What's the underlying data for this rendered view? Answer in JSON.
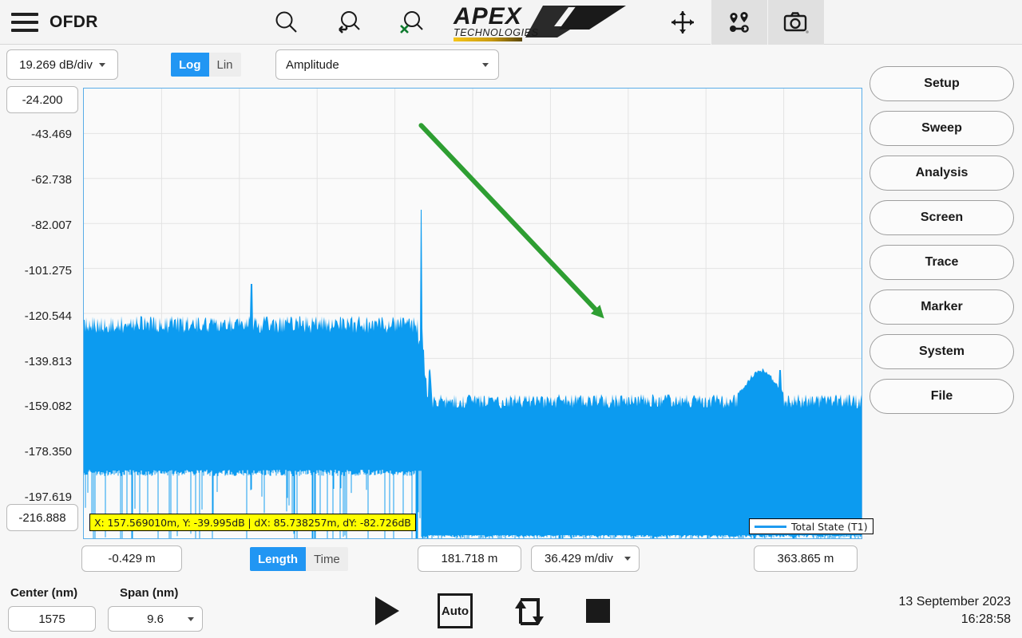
{
  "topbar": {
    "app_title": "OFDR",
    "menu_icon": "hamburger-menu-icon",
    "zoom_icon": "magnifier-zoom-icon",
    "zoom_back_icon": "magnifier-undo-icon",
    "zoom_clear_icon": "magnifier-clear-icon",
    "logo_main": "APEX",
    "logo_sub": "TECHNOLOGIES",
    "move_icon": "move-crosshair-icon",
    "markers_icon": "markers-pins-icon",
    "camera_icon": "camera-screenshot-icon"
  },
  "scale_controls": {
    "vertical_scale": "19.269 dB/div",
    "log_label": "Log",
    "lin_label": "Lin",
    "log_active": true,
    "measurement_mode": "Amplitude"
  },
  "y_axis": {
    "top_value": "-24.200",
    "bottom_value": "-216.888",
    "ticks": [
      "-43.469",
      "-62.738",
      "-82.007",
      "-101.275",
      "-120.544",
      "-139.813",
      "-159.082",
      "-178.350",
      "-197.619"
    ]
  },
  "marker_readout": "X: 157.569010m, Y: -39.995dB | dX: 85.738257m, dY: -82.726dB",
  "legend": {
    "trace_name": "Total State (T1)",
    "color": "#1e9bf0"
  },
  "x_axis": {
    "start": "-0.429 m",
    "center": "181.718 m",
    "scale": "36.429 m/div",
    "stop": "363.865 m",
    "length_label": "Length",
    "time_label": "Time",
    "length_active": true
  },
  "sidebar": {
    "items": [
      {
        "label": "Setup"
      },
      {
        "label": "Sweep"
      },
      {
        "label": "Analysis"
      },
      {
        "label": "Screen"
      },
      {
        "label": "Trace"
      },
      {
        "label": "Marker"
      },
      {
        "label": "System"
      },
      {
        "label": "File"
      }
    ]
  },
  "bottom": {
    "center_label": "Center (nm)",
    "center_value": "1575",
    "span_label": "Span (nm)",
    "span_value": "9.6",
    "play_icon": "play-single-sweep-icon",
    "auto_label": "Auto",
    "repeat_icon": "repeat-sweep-icon",
    "stop_icon": "stop-square-icon",
    "date": "13 September 2023",
    "time": "16:28:58"
  },
  "colors": {
    "accent": "#2196f3",
    "trace": "#0c9bf0",
    "annotation_arrow": "#2e9e32",
    "readout_bg": "#ffff00",
    "plot_border": "#5aade8"
  },
  "chart_data": {
    "type": "line",
    "title": "OFDR Reflectometry Trace",
    "xlabel": "Length (m)",
    "ylabel": "Amplitude (dB)",
    "xlim": [
      -0.429,
      363.865
    ],
    "ylim": [
      -216.888,
      -24.2
    ],
    "x_div": "36.429 m/div",
    "y_div": "19.269 dB/div",
    "grid": true,
    "legend_position": "bottom-right",
    "series": [
      {
        "name": "Total State (T1)",
        "color": "#0c9bf0",
        "fill": true,
        "description": "Dense backscatter noise band; high reflection peak near 157.6 m, secondary spike near 78 m and bump near 325 m"
      }
    ],
    "features": [
      {
        "name": "reflection-peak-main",
        "x_m": 157.56901,
        "y_db": -39.995
      },
      {
        "name": "reflection-peak-secondary",
        "x_m": 78.0,
        "y_db": -70.0
      },
      {
        "name": "bump-region",
        "x_m": 325.0,
        "y_db": -115.0
      },
      {
        "name": "noise-floor-left",
        "y_db": -160.0
      },
      {
        "name": "noise-floor-right",
        "y_db": -195.0
      }
    ],
    "annotations": [
      {
        "type": "arrow",
        "color": "#2e9e32",
        "from_x_m": 157.56901,
        "from_y_db": -39.995,
        "to_x_m": 243.307,
        "to_y_db": -122.721,
        "label": "dX: 85.738257m, dY: -82.726dB"
      }
    ]
  }
}
